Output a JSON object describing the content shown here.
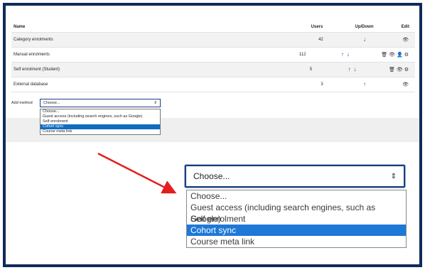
{
  "table": {
    "headers": {
      "name": "Name",
      "users": "Users",
      "updown": "Up/Down",
      "edit": "Edit"
    },
    "rows": [
      {
        "name": "Category enrolments",
        "users": "42",
        "updown": [
          "down"
        ],
        "edit": [
          "eye"
        ]
      },
      {
        "name": "Manual enrolments",
        "users": "112",
        "updown": [
          "up",
          "down"
        ],
        "edit": [
          "trash",
          "eye",
          "user",
          "gear"
        ]
      },
      {
        "name": "Self enrolment (Student)",
        "users": "5",
        "updown": [
          "up",
          "down"
        ],
        "edit": [
          "trash",
          "eye",
          "gear"
        ]
      },
      {
        "name": "External database",
        "users": "3",
        "updown": [
          "up"
        ],
        "edit": [
          "eye"
        ]
      }
    ]
  },
  "add_method": {
    "label": "Add method",
    "selected": "Choose...",
    "options": [
      "Choose...",
      "Guest access (including search engines, such as Google)",
      "Self enrolment",
      "Cohort sync",
      "Course meta link"
    ],
    "highlighted": "Cohort sync"
  },
  "zoom": {
    "selected": "Choose...",
    "options": [
      "Choose...",
      "Guest access (including search engines, such as Google)",
      "Self enrolment",
      "Cohort sync",
      "Course meta link"
    ],
    "highlighted": "Cohort sync"
  },
  "colors": {
    "frame": "#0f2b5b",
    "highlight": "#1e78d7",
    "arrow": "#e41e1e",
    "row_shade": "#f2f2f2"
  },
  "icons": {
    "up": "↑",
    "down": "↓",
    "eye": "👁",
    "trash": "🗑",
    "user": "👤",
    "gear": "⚙",
    "caret": "⇕"
  }
}
